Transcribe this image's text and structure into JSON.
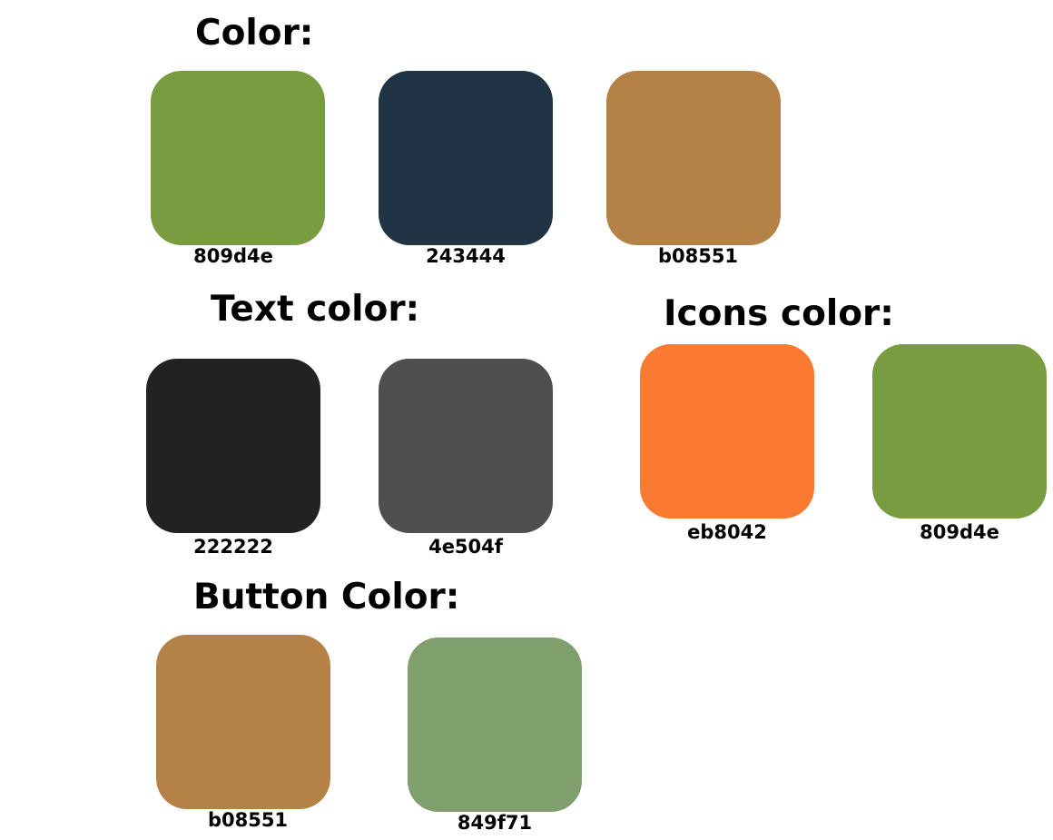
{
  "sections": {
    "color": {
      "title": "Color:",
      "swatches": [
        {
          "label": "809d4e",
          "color": "#7a9c40"
        },
        {
          "label": "243444",
          "color": "#213446"
        },
        {
          "label": "b08551",
          "color": "#b48246"
        }
      ]
    },
    "text_color": {
      "title": "Text color:",
      "swatches": [
        {
          "label": "222222",
          "color": "#222222"
        },
        {
          "label": "4e504f",
          "color": "#4e504f"
        }
      ]
    },
    "icons_color": {
      "title": "Icons color:",
      "swatches": [
        {
          "label": "eb8042",
          "color": "#fa7a32"
        },
        {
          "label": "809d4e",
          "color": "#7a9c40"
        }
      ]
    },
    "button_color": {
      "title": "Button Color:",
      "swatches": [
        {
          "label": "b08551",
          "color": "#b48246"
        },
        {
          "label": "849f71",
          "color": "#7f9f6c"
        }
      ]
    }
  }
}
